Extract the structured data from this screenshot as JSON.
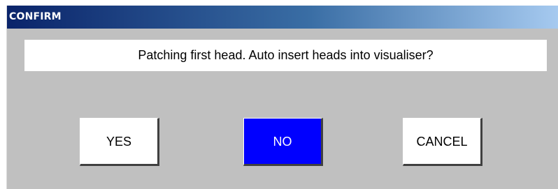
{
  "dialog": {
    "title": "CONFIRM",
    "message": "Patching first head. Auto insert heads into visualiser?",
    "buttons": {
      "yes_label": "YES",
      "no_label": "NO",
      "cancel_label": "CANCEL"
    },
    "selected_button": "NO"
  },
  "colors": {
    "titlebar_start": "#0a246a",
    "titlebar_end": "#a6caf0",
    "dialog_background": "#c0c0c0",
    "selected_button": "#0000ff"
  }
}
